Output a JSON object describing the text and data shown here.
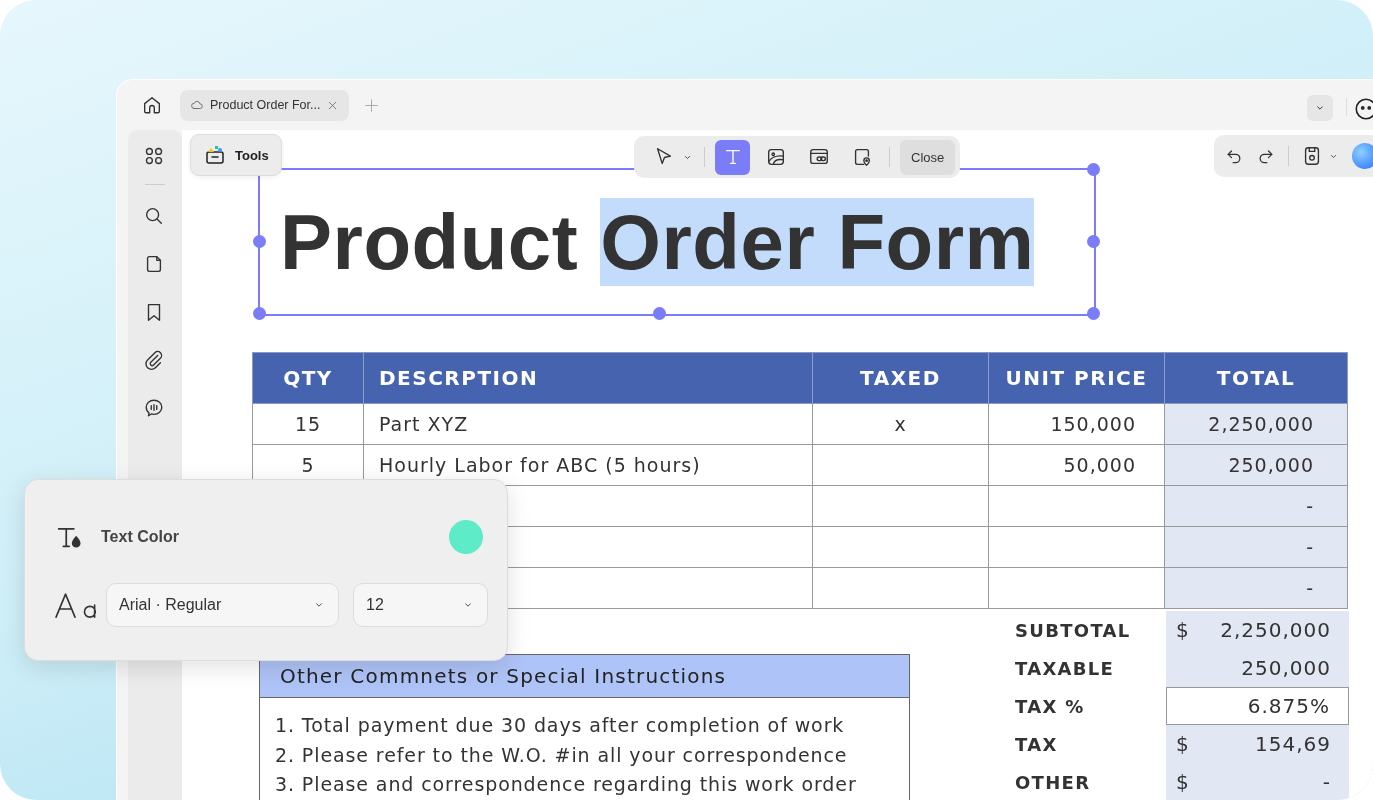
{
  "top_bar": {
    "tabs": [
      {
        "label": "Product Order For...",
        "selected": true
      }
    ]
  },
  "tools_button": {
    "label": "Tools"
  },
  "edit_toolbar": {
    "items": [
      {
        "kind": "pointer",
        "selected": false
      },
      {
        "kind": "text",
        "selected": true
      },
      {
        "kind": "image",
        "selected": false
      },
      {
        "kind": "link",
        "selected": false
      },
      {
        "kind": "stamp",
        "selected": false
      }
    ],
    "close_label": "Close"
  },
  "document": {
    "title": {
      "text": "Product ",
      "selected_text": "Order Form"
    },
    "table": {
      "columns": [
        "QTY",
        "DESCRPTION",
        "TAXED",
        "UNIT PRICE",
        "TOTAL"
      ],
      "rows": [
        {
          "qty": "15",
          "description": "Part XYZ",
          "taxed": "x",
          "unit_price": "150,000",
          "total": "2,250,000"
        },
        {
          "qty": "5",
          "description": "Hourly Labor for ABC (5 hours)",
          "unit_price": "50,000",
          "total": "250,000"
        },
        {
          "total": "-"
        },
        {
          "total": "-"
        },
        {
          "total": "-"
        }
      ]
    },
    "comments": {
      "heading": "Other Commnets or Special Instructions",
      "lines": [
        "1. Total payment due 30 days after completion of work",
        "2. Please refer to the W.O. #in all your correspondence",
        "3. Please and correspondence regarding this work order"
      ]
    },
    "totals": [
      {
        "label": "SUBTOTAL",
        "kind": "shaded",
        "currency": "$",
        "value": "2,250,000"
      },
      {
        "label": "TAXABLE",
        "kind": "shaded",
        "value": "250,000"
      },
      {
        "label": "TAX %",
        "kind": "input",
        "value": "6.875%"
      },
      {
        "label": "TAX",
        "kind": "shaded",
        "currency": "$",
        "value": "154,69"
      },
      {
        "label": "OTHER",
        "kind": "shaded",
        "currency": "$",
        "value": "-"
      }
    ]
  },
  "text_panel": {
    "color_label": "Text Color",
    "color": "#5eebc8",
    "font": "Arial · Regular",
    "size": "12"
  }
}
